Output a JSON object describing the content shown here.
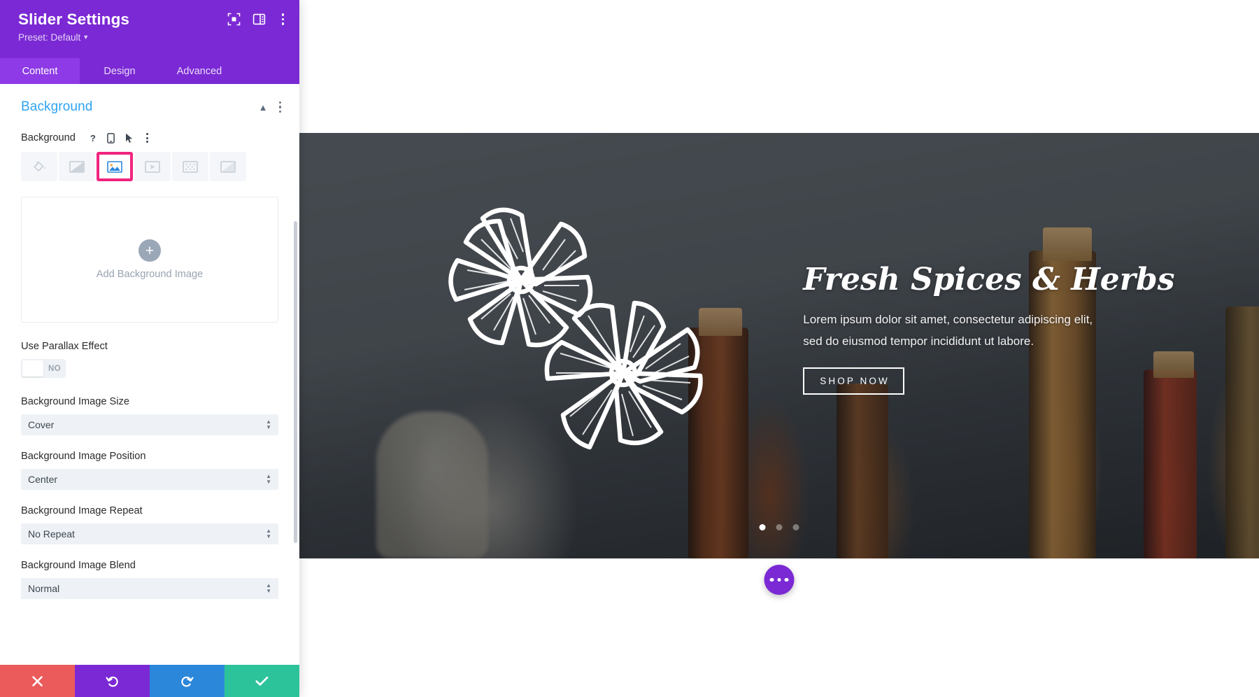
{
  "panel": {
    "title": "Slider Settings",
    "preset": "Preset: Default",
    "header_icons": [
      {
        "name": "focus-frame-icon"
      },
      {
        "name": "layout-panel-icon"
      },
      {
        "name": "kebab-menu-icon"
      }
    ],
    "tabs": [
      {
        "label": "Content",
        "active": true
      },
      {
        "label": "Design",
        "active": false
      },
      {
        "label": "Advanced",
        "active": false
      }
    ],
    "section": {
      "title": "Background",
      "collapse_icon": "chevron-up-icon",
      "kebab_icon": "kebab-menu-icon"
    },
    "background_field": {
      "label": "Background",
      "help_icon": "question-mark-icon",
      "responsive_icon": "mobile-device-icon",
      "hover_icon": "cursor-arrow-icon",
      "options_icon": "kebab-menu-icon",
      "types": [
        {
          "name": "background-color",
          "icon": "paint-bucket-icon",
          "selected": false
        },
        {
          "name": "background-gradient",
          "icon": "gradient-icon",
          "selected": false
        },
        {
          "name": "background-image",
          "icon": "image-icon",
          "selected": true
        },
        {
          "name": "background-video",
          "icon": "video-icon",
          "selected": false
        },
        {
          "name": "background-pattern",
          "icon": "pattern-icon",
          "selected": false
        },
        {
          "name": "background-mask",
          "icon": "mask-icon",
          "selected": false
        }
      ],
      "selected_outline_color": "#f0247e"
    },
    "upload": {
      "label": "Add Background Image",
      "plus_icon": "plus-icon"
    },
    "parallax": {
      "label": "Use Parallax Effect",
      "value": "NO"
    },
    "selects": [
      {
        "label": "Background Image Size",
        "value": "Cover",
        "name": "background-image-size"
      },
      {
        "label": "Background Image Position",
        "value": "Center",
        "name": "background-image-position"
      },
      {
        "label": "Background Image Repeat",
        "value": "No Repeat",
        "name": "background-image-repeat"
      },
      {
        "label": "Background Image Blend",
        "value": "Normal",
        "name": "background-image-blend"
      }
    ],
    "actions": [
      {
        "name": "discard-changes-button",
        "icon": "close-x-icon",
        "color": "#eb5b5b"
      },
      {
        "name": "undo-button",
        "icon": "undo-arrow-icon",
        "color": "#7b29d4"
      },
      {
        "name": "redo-button",
        "icon": "redo-arrow-icon",
        "color": "#2b87da"
      },
      {
        "name": "save-changes-button",
        "icon": "checkmark-icon",
        "color": "#2cc39b"
      }
    ],
    "accent_purple": "#7b29d4",
    "accent_blue": "#2ea3f2"
  },
  "canvas": {
    "hero": {
      "title": "Fresh Spices & Herbs",
      "subtitle_line1": "Lorem ipsum dolor sit amet, consectetur adipiscing elit,",
      "subtitle_line2": "sed do eiusmod tempor incididunt ut labore.",
      "button_label": "SHOP NOW",
      "slider_dots": [
        {
          "active": true
        },
        {
          "active": false
        },
        {
          "active": false
        }
      ]
    },
    "fab": {
      "name": "page-settings-fab",
      "icon": "ellipsis-icon"
    }
  }
}
